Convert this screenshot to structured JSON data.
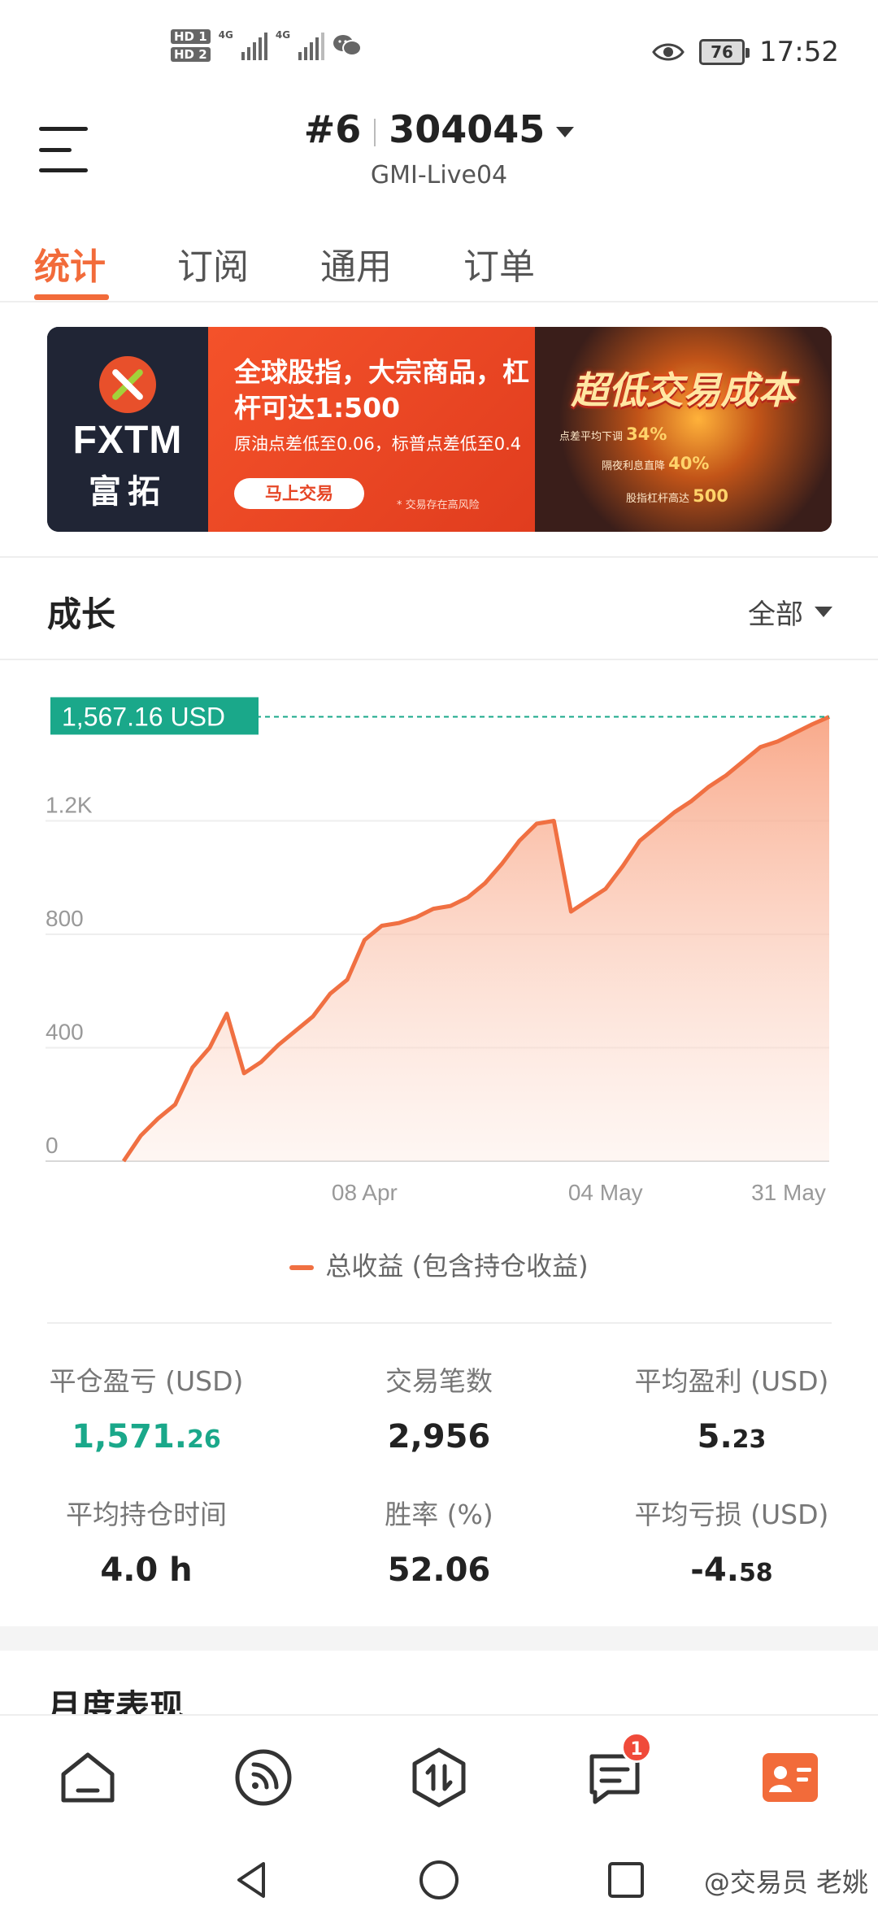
{
  "status_bar": {
    "hd1": "HD 1",
    "hd2": "HD 2",
    "net1": "4G",
    "net2": "4G",
    "battery": "76",
    "time": "17:52"
  },
  "header": {
    "account_rank": "#6",
    "account_number": "304045",
    "server": "GMI-Live04"
  },
  "tabs": [
    {
      "label": "统计",
      "active": true
    },
    {
      "label": "订阅",
      "active": false
    },
    {
      "label": "通用",
      "active": false
    },
    {
      "label": "订单",
      "active": false
    }
  ],
  "banner": {
    "brand": "FXTM",
    "brand_cn": "富拓",
    "headline": "全球股指，大宗商品，杠杆可达1:500",
    "subline": "原油点差低至0.06，标普点差低至0.4",
    "button": "马上交易",
    "risk": "* 交易存在高风险",
    "big_title": "超低交易成本",
    "line1_label": "点差平均下调",
    "line1_value": "34%",
    "line2_label": "隔夜利息直降",
    "line2_value": "40%",
    "line3_label": "股指杠杆高达",
    "line3_value": "500"
  },
  "growth": {
    "title": "成长",
    "range": "全部",
    "current_label": "1,567.16 USD",
    "legend": "总收益 (包含持仓收益)"
  },
  "chart_data": {
    "type": "area",
    "y_ticks": [
      "0",
      "400",
      "800",
      "1.2K"
    ],
    "x_ticks": [
      "08 Apr",
      "04 May",
      "31 May"
    ],
    "ylim": [
      0,
      1600
    ],
    "current_value": 1567.16,
    "series": [
      {
        "name": "总收益 (包含持仓收益)",
        "color": "#f07042",
        "x": [
          "Mar 11",
          "Mar 13",
          "Mar 15",
          "Mar 17",
          "Mar 19",
          "Mar 21",
          "Mar 23",
          "Mar 25",
          "Mar 27",
          "Mar 29",
          "Mar 31",
          "Apr 02",
          "Apr 04",
          "Apr 06",
          "Apr 08",
          "Apr 10",
          "Apr 12",
          "Apr 14",
          "Apr 16",
          "Apr 18",
          "Apr 20",
          "Apr 22",
          "Apr 24",
          "Apr 26",
          "Apr 28",
          "Apr 30",
          "May 01",
          "May 02",
          "May 04",
          "May 06",
          "May 08",
          "May 10",
          "May 12",
          "May 14",
          "May 16",
          "May 18",
          "May 20",
          "May 22",
          "May 24",
          "May 26",
          "May 28",
          "May 31"
        ],
        "y": [
          0,
          90,
          150,
          200,
          330,
          400,
          520,
          310,
          350,
          410,
          460,
          510,
          590,
          640,
          780,
          830,
          840,
          860,
          890,
          900,
          930,
          980,
          1050,
          1130,
          1190,
          1200,
          880,
          920,
          960,
          1040,
          1130,
          1180,
          1230,
          1270,
          1320,
          1360,
          1410,
          1460,
          1480,
          1510,
          1540,
          1567
        ]
      }
    ]
  },
  "stats": {
    "closed_pl_label": "平仓盈亏 (USD)",
    "closed_pl_int": "1,571.",
    "closed_pl_dec": "26",
    "trades_label": "交易笔数",
    "trades_value": "2,956",
    "avg_profit_label": "平均盈利 (USD)",
    "avg_profit_int": "5.",
    "avg_profit_dec": "23",
    "avg_hold_label": "平均持仓时间",
    "avg_hold_value": "4.0 h",
    "winrate_label": "胜率 (%)",
    "winrate_value": "52.06",
    "avg_loss_label": "平均亏损 (USD)",
    "avg_loss_int": "-4.",
    "avg_loss_dec": "58"
  },
  "monthly": {
    "title": "月度表现"
  },
  "bottom_nav": {
    "messages_badge": "1",
    "accent": "#f26b3a"
  },
  "watermark": "@交易员 老姚"
}
